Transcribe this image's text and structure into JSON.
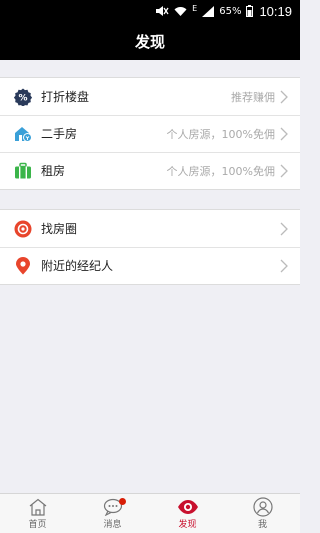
{
  "status_bar": {
    "network": "E",
    "battery": "65%",
    "time": "10:19"
  },
  "header": {
    "title": "发现"
  },
  "group1": [
    {
      "label": "打折楼盘",
      "right": "推荐赚佣",
      "icon": "discount-icon"
    },
    {
      "label": "二手房",
      "right": "个人房源，100%免佣",
      "icon": "house-icon"
    },
    {
      "label": "租房",
      "right": "个人房源，100%免佣",
      "icon": "suitcase-icon"
    }
  ],
  "group2": [
    {
      "label": "找房圈",
      "icon": "circle-icon"
    },
    {
      "label": "附近的经纪人",
      "icon": "location-pin-icon"
    }
  ],
  "tabs": [
    {
      "label": "首页",
      "icon": "home-icon"
    },
    {
      "label": "消息",
      "icon": "message-icon",
      "badge": true
    },
    {
      "label": "发现",
      "icon": "eye-icon",
      "active": true
    },
    {
      "label": "我",
      "icon": "user-icon"
    }
  ],
  "colors": {
    "accent": "#c8102e",
    "badge": "#d81e06"
  }
}
